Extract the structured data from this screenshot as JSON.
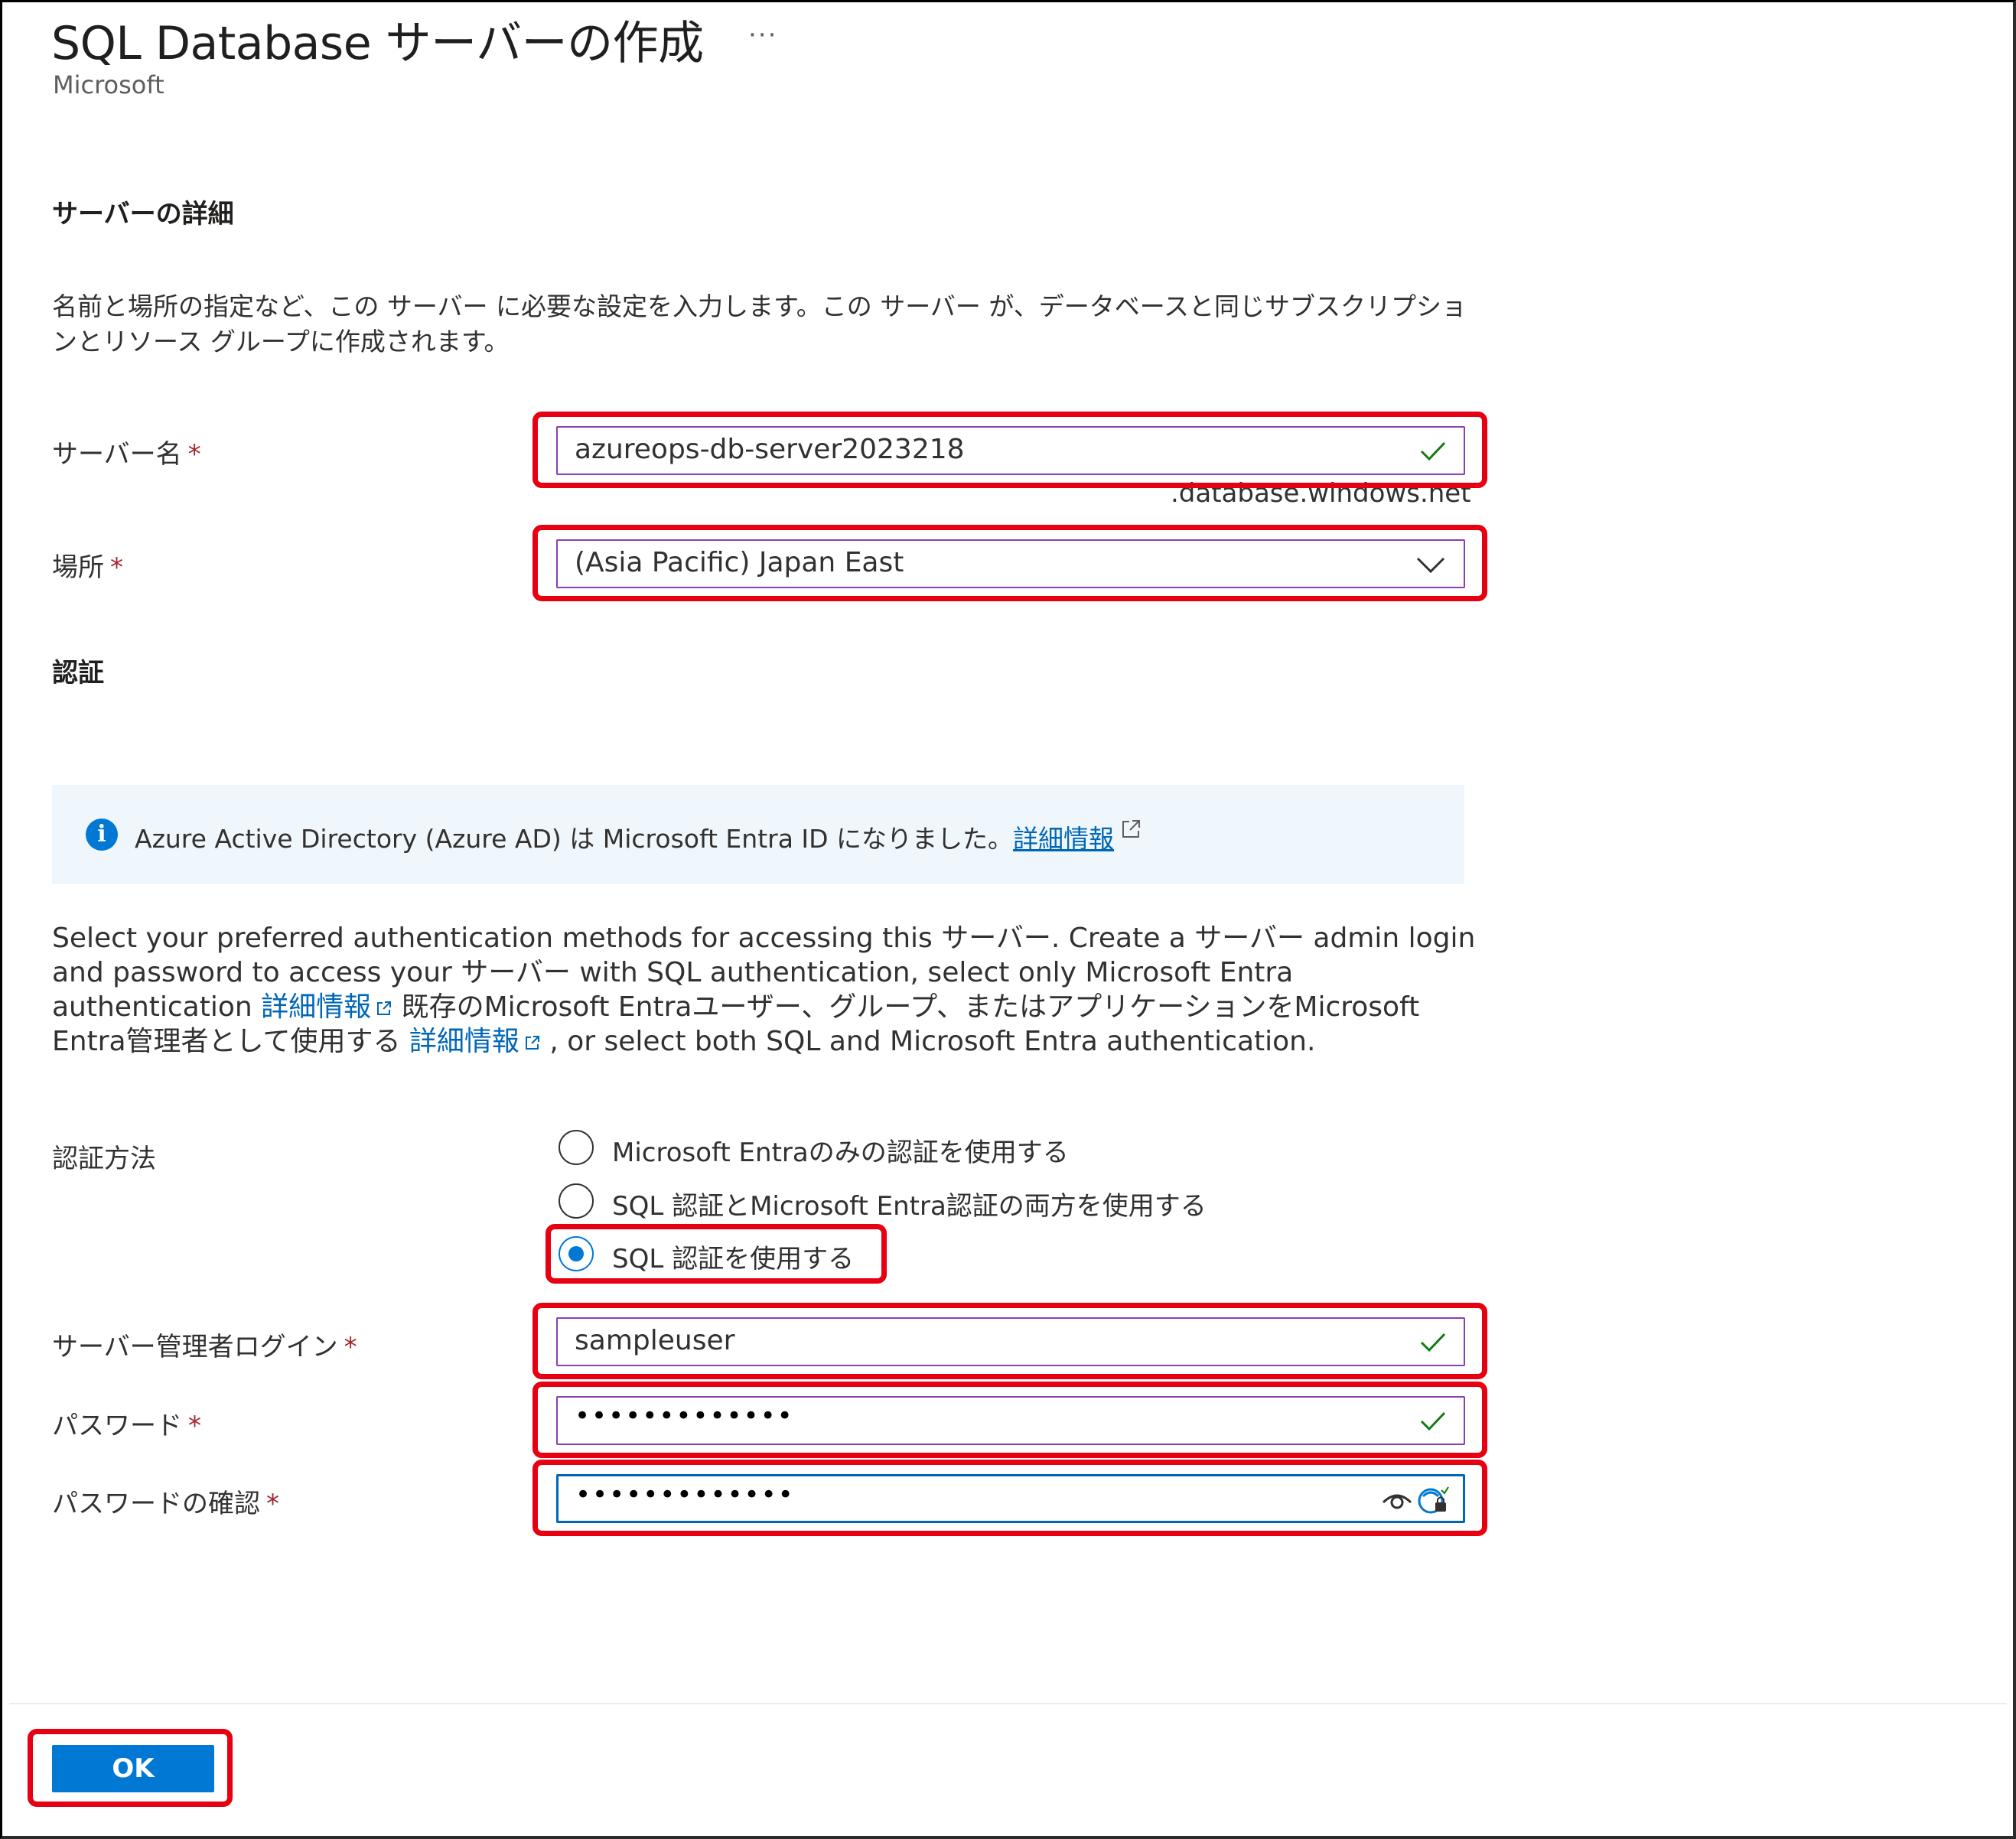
{
  "page": {
    "title": "SQL Database サーバーの作成",
    "more_label": "···",
    "publisher": "Microsoft"
  },
  "server_details": {
    "heading": "サーバーの詳細",
    "description": "名前と場所の指定など、この サーバー に必要な設定を入力します。この サーバー が、データベースと同じサブスクリプションとリソース グループに作成されます。",
    "server_name": {
      "label": "サーバー名",
      "required": "*",
      "value": "azureops-db-server2023218",
      "suffix": ".database.windows.net"
    },
    "location": {
      "label": "場所",
      "required": "*",
      "value": "(Asia Pacific) Japan East"
    }
  },
  "auth": {
    "heading": "認証",
    "info_text": "Azure Active Directory (Azure AD) は Microsoft Entra ID になりました。",
    "info_link": "詳細情報",
    "para_part1": "Select your preferred authentication methods for accessing this サーバー. Create a サーバー admin login and password to access your サーバー with SQL authentication, select only Microsoft Entra authentication ",
    "para_link1": "詳細情報",
    "para_part2": " 既存のMicrosoft Entraユーザー、グループ、またはアプリケーションをMicrosoft Entra管理者として使用する ",
    "para_link2": "詳細情報",
    "para_part3": " , or select both SQL and Microsoft Entra authentication.",
    "method_label": "認証方法",
    "options": [
      {
        "label": "Microsoft Entraのみの認証を使用する",
        "selected": false
      },
      {
        "label": "SQL 認証とMicrosoft Entra認証の両方を使用する",
        "selected": false
      },
      {
        "label": "SQL 認証を使用する",
        "selected": true
      }
    ],
    "admin_login": {
      "label": "サーバー管理者ログイン",
      "required": "*",
      "value": "sampleuser"
    },
    "password": {
      "label": "パスワード",
      "required": "*",
      "value": "•••••••••••••"
    },
    "confirm_password": {
      "label": "パスワードの確認",
      "required": "*",
      "value": "•••••••••••••"
    }
  },
  "footer": {
    "ok_label": "OK"
  },
  "colors": {
    "accent": "#0078d4",
    "highlight": "#e60012",
    "valid": "#107c10",
    "field_border": "#8a3fb5",
    "info_bg": "#eff6fc"
  }
}
